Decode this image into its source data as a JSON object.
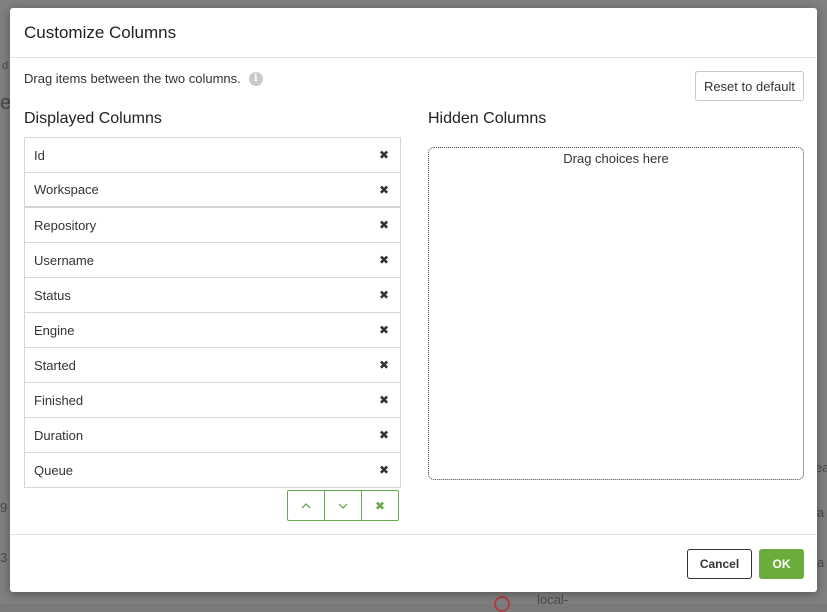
{
  "dialog": {
    "title": "Customize Columns",
    "instructions": "Drag items between the two columns.",
    "reset_label": "Reset to default",
    "displayed_title": "Displayed Columns",
    "hidden_title": "Hidden Columns",
    "drop_placeholder": "Drag choices here",
    "displayed_columns": [
      {
        "label": "Id"
      },
      {
        "label": "Workspace"
      },
      {
        "label": "Repository"
      },
      {
        "label": "Username"
      },
      {
        "label": "Status"
      },
      {
        "label": "Engine"
      },
      {
        "label": "Started"
      },
      {
        "label": "Finished"
      },
      {
        "label": "Duration"
      },
      {
        "label": "Queue"
      }
    ],
    "cancel_label": "Cancel",
    "ok_label": "OK"
  },
  "background": {
    "fragments": [
      "d",
      "e",
      "9",
      "3",
      "ea",
      "a",
      "a",
      "local-",
      "ea"
    ]
  },
  "colors": {
    "accent": "#6aad3d",
    "overlay": "#808080"
  }
}
